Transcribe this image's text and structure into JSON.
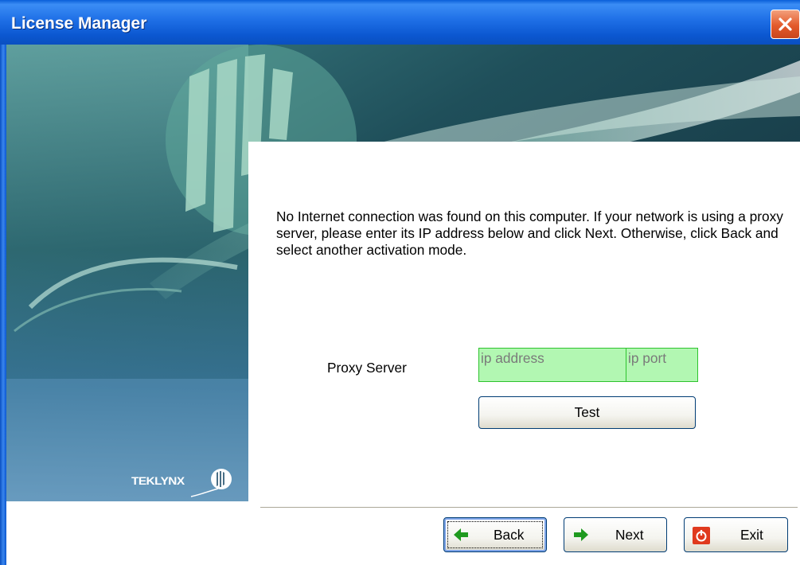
{
  "window": {
    "title": "License Manager",
    "close_icon": "close-icon"
  },
  "banner": {
    "logo_text": "TEKLYNX"
  },
  "content": {
    "message": "No Internet connection was found on this computer. If your network is using a proxy server, please enter its IP address below and click Next. Otherwise, click Back and select another activation mode.",
    "proxy_label": "Proxy Server",
    "ip_placeholder": "ip address",
    "ip_value": "",
    "port_placeholder": "ip port",
    "port_value": "",
    "test_label": "Test"
  },
  "footer": {
    "back_label": "Back",
    "next_label": "Next",
    "exit_label": "Exit",
    "back_icon": "arrow-left-icon",
    "next_icon": "arrow-right-icon",
    "exit_icon": "power-icon"
  },
  "colors": {
    "titlebar": "#0b57d0",
    "field_bg": "#b2f7b2",
    "field_border": "#2ec32e",
    "arrow_green": "#1f9a1f",
    "exit_red": "#e03a1e"
  }
}
